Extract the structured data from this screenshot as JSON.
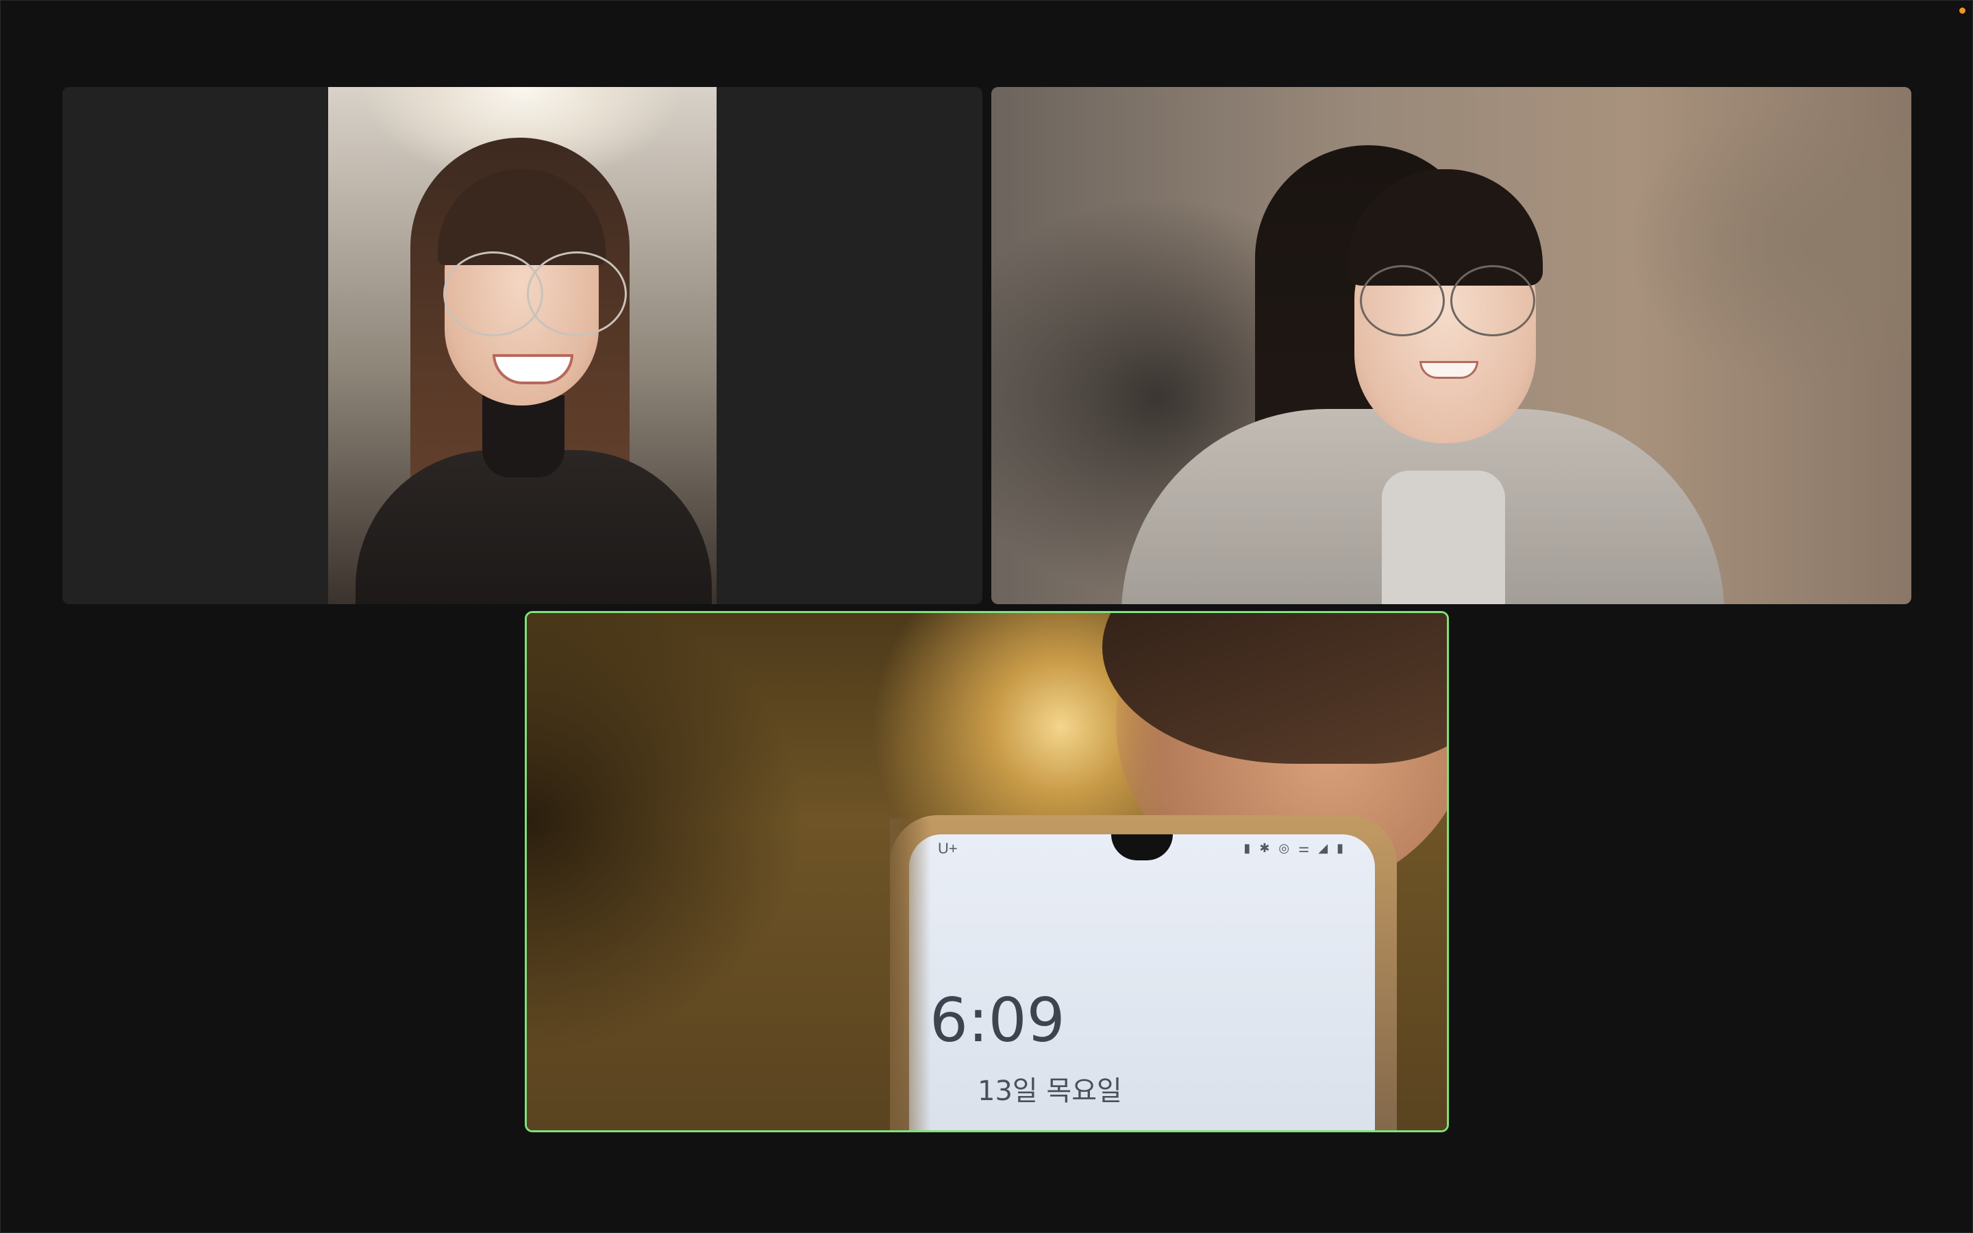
{
  "meeting": {
    "status_dot_color": "#f0932b",
    "active_speaker_border_color": "#7fe27a"
  },
  "participants": [
    {
      "tile": "participant-tile-1",
      "active_speaker": false
    },
    {
      "tile": "participant-tile-2",
      "active_speaker": false
    },
    {
      "tile": "participant-tile-3",
      "active_speaker": true
    }
  ],
  "phone_screen": {
    "carrier": "U+",
    "status_icons": "▮ ✱ ◎ ⚌ ◢ ▮",
    "time": "6:09",
    "date": "13일 목요일"
  }
}
